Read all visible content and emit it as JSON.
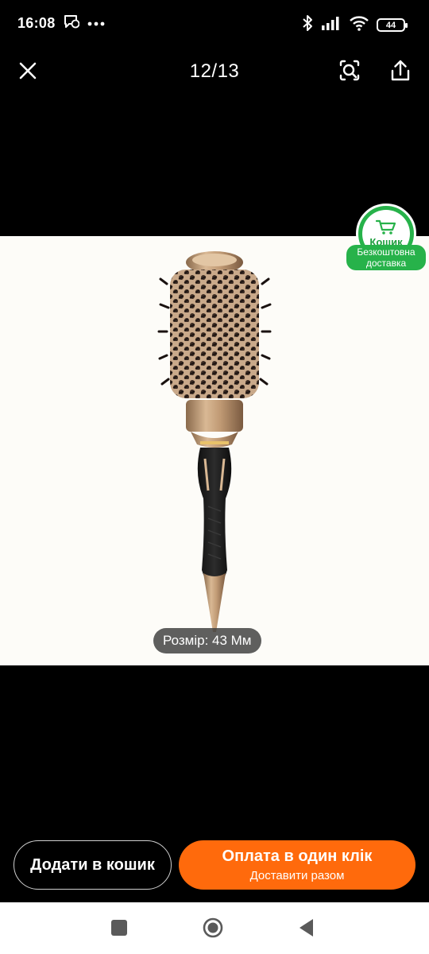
{
  "status_bar": {
    "time": "16:08",
    "battery": "44",
    "icons": [
      "chat-notification-icon",
      "more-dots-icon",
      "bluetooth-icon",
      "signal-icon",
      "wifi-icon",
      "battery-icon"
    ]
  },
  "toolbar": {
    "counter": "12/13",
    "icons": [
      "close-icon",
      "lens-search-icon",
      "share-icon"
    ]
  },
  "product_image": {
    "size_label": "Розмір: 43 Мм"
  },
  "cart_badge": {
    "label": "Кошик",
    "line1": "Безкоштовна",
    "line2": "доставка",
    "color": "#27b24a"
  },
  "actions": {
    "add_to_cart": "Додати в кошик",
    "buy_main": "Оплата в один клік",
    "buy_sub": "Доставити разом",
    "buy_color": "#ff6a0c"
  },
  "nav": {
    "icons": [
      "recents-square-icon",
      "home-circle-icon",
      "back-triangle-icon"
    ]
  }
}
